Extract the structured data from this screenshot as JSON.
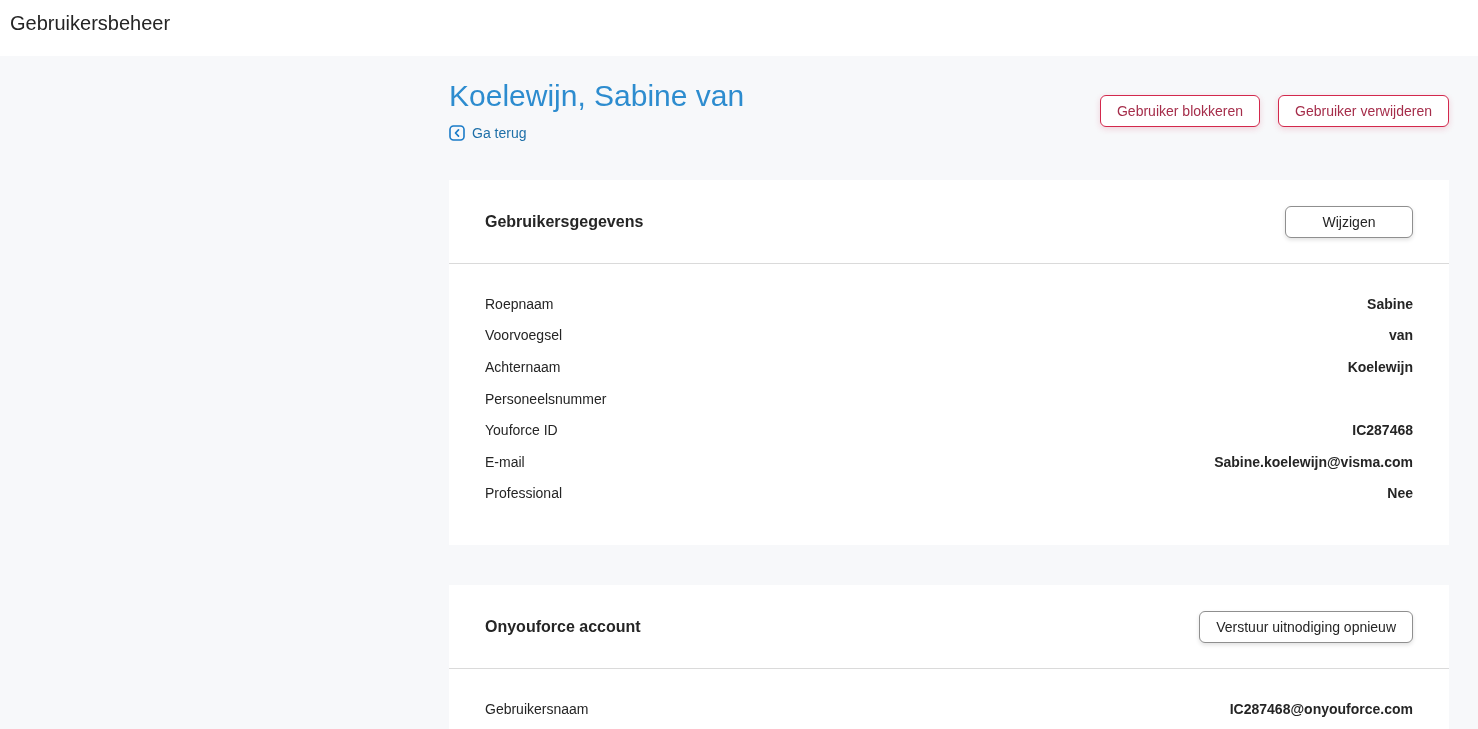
{
  "header": {
    "title": "Gebruikersbeheer"
  },
  "user": {
    "name": "Koelewijn, Sabine van",
    "back_link": "Ga terug"
  },
  "actions": [
    {
      "label": "Gebruiker blokkeren"
    },
    {
      "label": "Gebruiker verwijderen"
    }
  ],
  "cards": [
    {
      "title": "Gebruikersgegevens",
      "button": "Wijzigen",
      "rows": [
        {
          "label": "Roepnaam",
          "value": "Sabine"
        },
        {
          "label": "Voorvoegsel",
          "value": "van"
        },
        {
          "label": "Achternaam",
          "value": "Koelewijn"
        },
        {
          "label": "Personeelsnummer"
        },
        {
          "label": "Youforce ID",
          "value": "IC287468"
        },
        {
          "label": "E-mail",
          "value": "Sabine.koelewijn@visma.com"
        },
        {
          "label": "Professional",
          "value": "Nee"
        }
      ]
    },
    {
      "title": "Onyouforce account",
      "button": "Verstuur uitnodiging opnieuw",
      "rows": [
        {
          "label": "Gebruikersnaam",
          "value": "IC287468@onyouforce.com"
        }
      ]
    }
  ]
}
